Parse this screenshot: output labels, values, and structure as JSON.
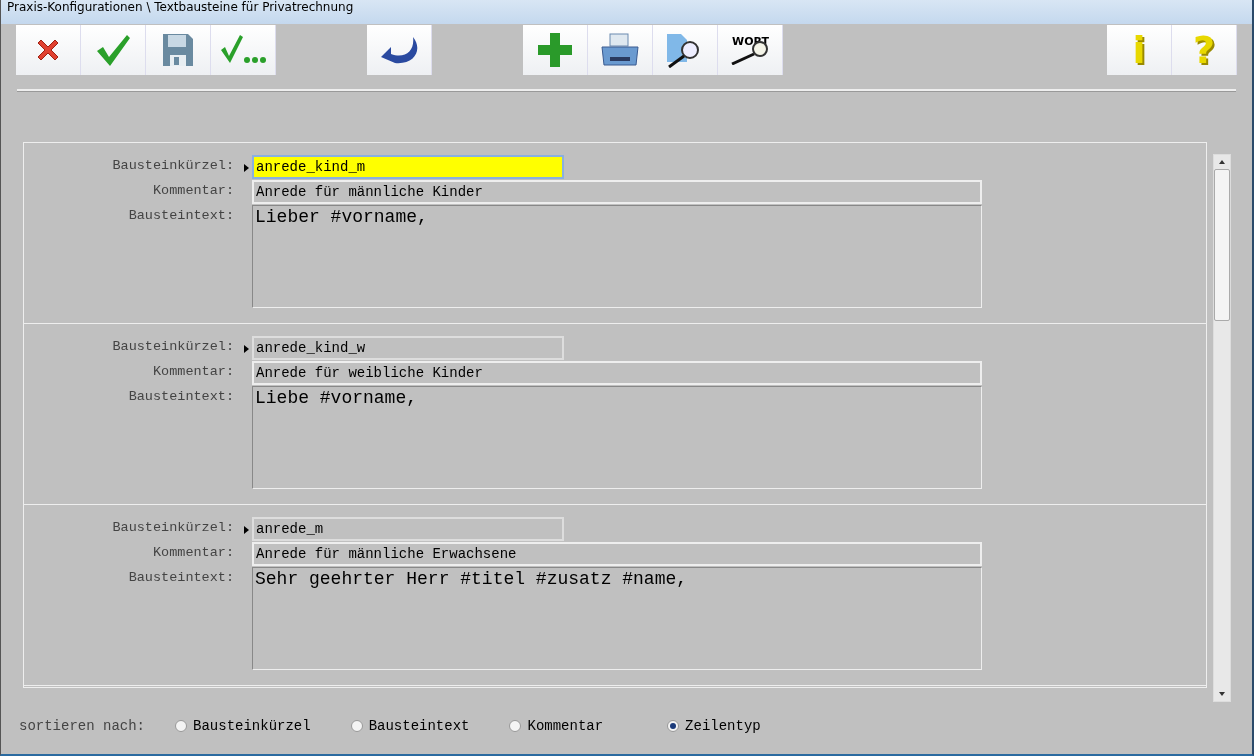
{
  "window": {
    "title": "Praxis-Konfigurationen \\ Textbausteine für Privatrechnung"
  },
  "toolbar": [
    [
      {
        "kind": "cancel"
      },
      {
        "kind": "ok"
      },
      {
        "kind": "save"
      },
      {
        "kind": "ok-more"
      }
    ],
    [
      {
        "kind": "undo"
      }
    ],
    [
      {
        "kind": "add"
      },
      {
        "kind": "print"
      },
      {
        "kind": "search"
      },
      {
        "kind": "word-search",
        "glyph": "WORT"
      }
    ],
    [
      {
        "kind": "info",
        "glyph": "i"
      },
      {
        "kind": "help",
        "glyph": "?"
      }
    ]
  ],
  "records": [
    {
      "shortcut_label": "Bausteinkürzel:",
      "shortcut": "anrede_kind_m",
      "comment_label": "Kommentar:",
      "comment": "Anrede für männliche Kinder",
      "text_label": "Bausteintext:",
      "text": "Lieber #vorname,",
      "selected": true
    },
    {
      "shortcut_label": "Bausteinkürzel:",
      "shortcut": "anrede_kind_w",
      "comment_label": "Kommentar:",
      "comment": "Anrede für weibliche Kinder",
      "text_label": "Bausteintext:",
      "text": "Liebe #vorname,",
      "selected": false
    },
    {
      "shortcut_label": "Bausteinkürzel:",
      "shortcut": "anrede_m",
      "comment_label": "Kommentar:",
      "comment": "Anrede für männliche Erwachsene",
      "text_label": "Bausteintext:",
      "text": "Sehr geehrter Herr #titel #zusatz #name,",
      "selected": false
    }
  ],
  "sort": {
    "label": "sortieren nach:",
    "options": [
      {
        "label": "Bausteinkürzel",
        "selected": false
      },
      {
        "label": "Bausteintext",
        "selected": false
      },
      {
        "label": "Kommentar",
        "selected": false
      },
      {
        "label": "Zeilentyp",
        "selected": true
      }
    ]
  }
}
